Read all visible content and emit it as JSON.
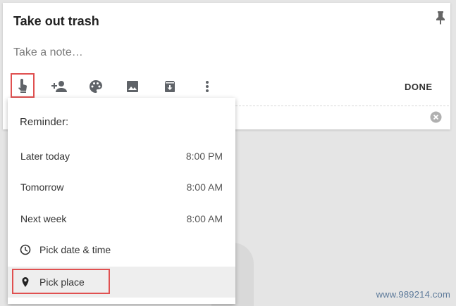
{
  "note": {
    "title": "Take out trash",
    "body_placeholder": "Take a note…"
  },
  "toolbar": {
    "icons": [
      "reminder-icon",
      "collaborator-icon",
      "palette-icon",
      "image-icon",
      "archive-icon",
      "more-icon"
    ],
    "done_label": "DONE"
  },
  "reminder_menu": {
    "heading": "Reminder:",
    "items": [
      {
        "label": "Later today",
        "time": "8:00 PM"
      },
      {
        "label": "Tomorrow",
        "time": "8:00 AM"
      },
      {
        "label": "Next week",
        "time": "8:00 AM"
      }
    ],
    "pick_date_label": "Pick date & time",
    "pick_place_label": "Pick place"
  },
  "watermark": "www.989214.com",
  "colors": {
    "highlight_border": "#e05050",
    "menu_hover": "#eeeeee",
    "icon": "#5f6368"
  }
}
